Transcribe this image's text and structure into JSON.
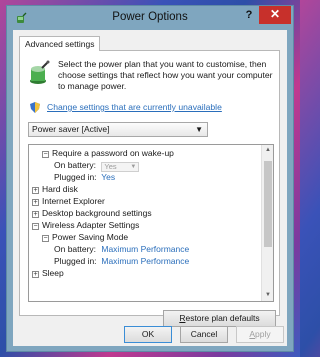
{
  "window": {
    "title": "Power Options",
    "help_label": "?",
    "close_label": "✕"
  },
  "tab": {
    "label": "Advanced settings"
  },
  "intro": {
    "text": "Select the power plan that you want to customise, then choose settings that reflect how you want your computer to manage power."
  },
  "change_link": {
    "label": "Change settings that are currently unavailable"
  },
  "plan_select": {
    "value": "Power saver [Active]"
  },
  "tree": {
    "require_password": {
      "label": "Require a password on wake-up",
      "on_battery_label": "On battery:",
      "on_battery_value": "Yes",
      "plugged_in_label": "Plugged in:",
      "plugged_in_value": "Yes"
    },
    "hard_disk": "Hard disk",
    "internet_explorer": "Internet Explorer",
    "desktop_background": "Desktop background settings",
    "wireless_adapter": {
      "label": "Wireless Adapter Settings",
      "power_saving_mode": "Power Saving Mode",
      "on_battery_label": "On battery:",
      "on_battery_value": "Maximum Performance",
      "plugged_in_label": "Plugged in:",
      "plugged_in_value": "Maximum Performance"
    },
    "sleep": "Sleep"
  },
  "buttons": {
    "restore_first": "R",
    "restore_rest": "estore plan defaults",
    "ok": "OK",
    "cancel": "Cancel",
    "apply_first": "A",
    "apply_rest": "pply"
  },
  "colors": {
    "link": "#2a6ebb",
    "close_button": "#c7302b",
    "frame": "#7fa6bf"
  }
}
